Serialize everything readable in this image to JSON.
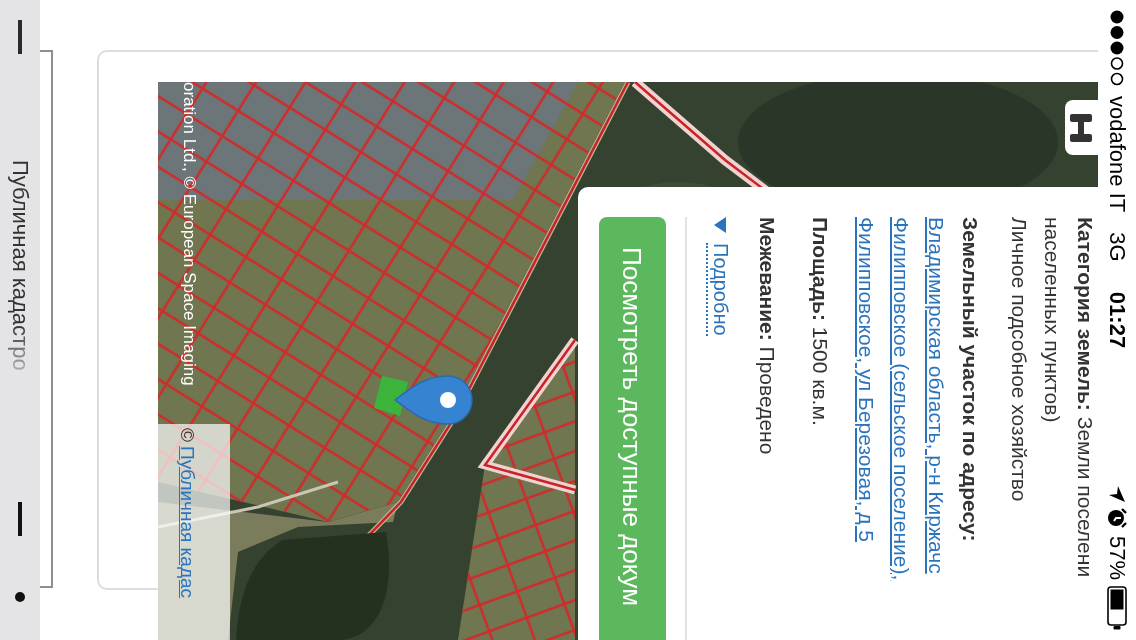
{
  "status_bar": {
    "carrier": "vodafone IT",
    "network": "3G",
    "time": "01:27",
    "battery": "57%"
  },
  "map": {
    "attribution": "oration Ltd., © European Space Imaging",
    "attribution_sign": "©",
    "attribution_link": "Публичная кадас"
  },
  "info_panel": {
    "category_lines": [
      "**Категория земель:** Земли поселени",
      "населенных пунктов)"
    ],
    "land_use": "Личное подсобное хозяйство",
    "address_heading": "Земельный участок по адресу:",
    "address_lines": [
      "Владимирская область, р-н Киржачс",
      "Филипповское (сельское поселение),",
      "Филипповское, ул Березовая, д 5"
    ],
    "area": "**Площадь:** 1500 кв.м.",
    "survey": "**Межевание:** Проведено",
    "details_link": "Подробно",
    "documents_button": "Посмотреть доступные докум"
  },
  "bottom_bar": {
    "title": "Публичная кадастро"
  }
}
